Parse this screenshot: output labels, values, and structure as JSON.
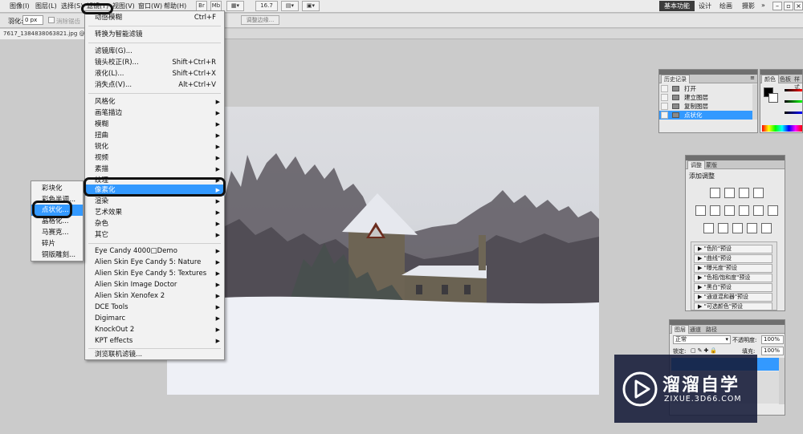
{
  "menubar": {
    "items": [
      "图像(I)",
      "图层(L)",
      "选择(S)",
      "滤镜(T)",
      "视图(V)",
      "窗口(W)",
      "帮助(H)"
    ],
    "zoom": "16.7",
    "workspace_active": "基本功能",
    "workspace_others": [
      "设计",
      "绘画",
      "摄影"
    ]
  },
  "options": {
    "feather_label": "羽化:",
    "feather_value": "0 px",
    "antialias_label": "消除锯齿",
    "refine_edge": "调整边缘..."
  },
  "doc_tab": "7617_1384838063821.jpg @ 16.7",
  "filter_menu": {
    "items": [
      {
        "label": "动感模糊",
        "shortcut": "Ctrl+F"
      },
      {
        "label": "转换为智能滤镜"
      },
      {
        "label": "滤镜库(G)..."
      },
      {
        "label": "镜头校正(R)...",
        "shortcut": "Shift+Ctrl+R"
      },
      {
        "label": "液化(L)...",
        "shortcut": "Shift+Ctrl+X"
      },
      {
        "label": "消失点(V)...",
        "shortcut": "Alt+Ctrl+V"
      },
      {
        "label": "风格化",
        "submenu": true
      },
      {
        "label": "画笔描边",
        "submenu": true
      },
      {
        "label": "模糊",
        "submenu": true
      },
      {
        "label": "扭曲",
        "submenu": true
      },
      {
        "label": "锐化",
        "submenu": true
      },
      {
        "label": "视频",
        "submenu": true
      },
      {
        "label": "素描",
        "submenu": true
      },
      {
        "label": "纹理",
        "submenu": true
      },
      {
        "label": "像素化",
        "submenu": true
      },
      {
        "label": "渲染",
        "submenu": true
      },
      {
        "label": "艺术效果",
        "submenu": true
      },
      {
        "label": "杂色",
        "submenu": true
      },
      {
        "label": "其它",
        "submenu": true
      },
      {
        "label": "Eye Candy 4000□Demo",
        "submenu": true
      },
      {
        "label": "Alien Skin Eye Candy 5: Nature",
        "submenu": true
      },
      {
        "label": "Alien Skin Eye Candy 5: Textures",
        "submenu": true
      },
      {
        "label": "Alien Skin Image Doctor",
        "submenu": true
      },
      {
        "label": "Alien Skin Xenofex 2",
        "submenu": true
      },
      {
        "label": "DCE Tools",
        "submenu": true
      },
      {
        "label": "Digimarc",
        "submenu": true
      },
      {
        "label": "KnockOut 2",
        "submenu": true
      },
      {
        "label": "KPT effects",
        "submenu": true
      },
      {
        "label": "浏览联机滤镜..."
      }
    ]
  },
  "pixelate_submenu": {
    "items": [
      "彩块化",
      "彩色半调...",
      "点状化...",
      "晶格化...",
      "马赛克...",
      "碎片",
      "铜版雕刻..."
    ]
  },
  "history_panel": {
    "tabs": [
      "历史记录"
    ],
    "rows": [
      "打开",
      "建立图层",
      "复制图层",
      "点状化"
    ],
    "color_tabs": [
      "颜色",
      "色板",
      "样式"
    ]
  },
  "adjustments_panel": {
    "tabs": [
      "调整",
      "蒙版"
    ],
    "title": "添加调整",
    "presets": [
      "\"色阶\"预设",
      "\"曲线\"预设",
      "\"曝光度\"预设",
      "\"色相/饱和度\"预设",
      "\"黑白\"预设",
      "\"通道混和器\"预设",
      "\"可选颜色\"预设"
    ]
  },
  "layers_panel": {
    "tabs": [
      "图层",
      "通道",
      "路径"
    ],
    "blend_mode": "正常",
    "opacity_label": "不透明度:",
    "opacity_value": "100%",
    "lock_label": "锁定:",
    "fill_label": "填充:",
    "fill_value": "100%"
  },
  "watermark": {
    "title": "溜溜自学",
    "url": "ZIXUE.3D66.COM"
  },
  "colors": {
    "highlight": "#3399ff",
    "watermark_bg": "#141a38"
  }
}
